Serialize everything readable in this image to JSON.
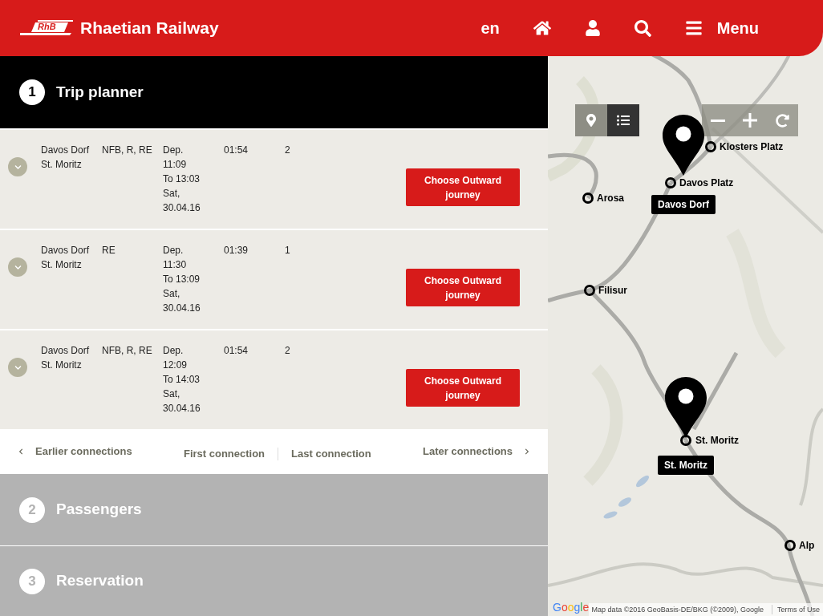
{
  "header": {
    "logo_text": "RhB",
    "title": "Rhaetian Railway",
    "language": "en",
    "menu_label": "Menu"
  },
  "steps": [
    {
      "number": "1",
      "title": "Trip planner",
      "active": true,
      "connections": [
        {
          "from": "Davos Dorf",
          "to": "St. Moritz",
          "products": "NFB, R, RE",
          "departure": "Dep. 11:09",
          "arrival": "To 13:03",
          "date": "Sat, 30.04.16",
          "duration": "01:54",
          "changes": "2",
          "expanded": false,
          "action": "Choose Outward journey"
        },
        {
          "from": "Davos Dorf",
          "to": "St. Moritz",
          "products": "RE",
          "departure": "Dep. 11:30",
          "arrival": "To 13:09",
          "date": "Sat, 30.04.16",
          "duration": "01:39",
          "changes": "1",
          "expanded": false,
          "action": "Choose Outward journey"
        },
        {
          "from": "Davos Dorf",
          "to": "St. Moritz",
          "products": "NFB, R, RE",
          "departure": "Dep. 12:09",
          "arrival": "To 14:03",
          "date": "Sat, 30.04.16",
          "duration": "01:54",
          "changes": "2",
          "expanded": false,
          "action": "Choose Outward journey"
        }
      ],
      "pager": {
        "earlier": "Earlier connections",
        "first": "First connection",
        "last": "Last connection",
        "later": "Later connections"
      }
    },
    {
      "number": "2",
      "title": "Passengers",
      "active": false
    },
    {
      "number": "3",
      "title": "Reservation",
      "active": false
    }
  ],
  "map": {
    "view_toggle": [
      {
        "kind": "pin",
        "selected": false
      },
      {
        "kind": "list",
        "selected": true
      }
    ],
    "stations": [
      "Klosters Platz",
      "Davos Platz",
      "Arosa",
      "Filisur",
      "St. Moritz",
      "Alp"
    ],
    "pin_labels": [
      "Davos Dorf",
      "St. Moritz"
    ],
    "logo": "Google",
    "attribution": "Map data ©2016 GeoBasis-DE/BKG (©2009), Google",
    "terms": "Terms of Use"
  }
}
